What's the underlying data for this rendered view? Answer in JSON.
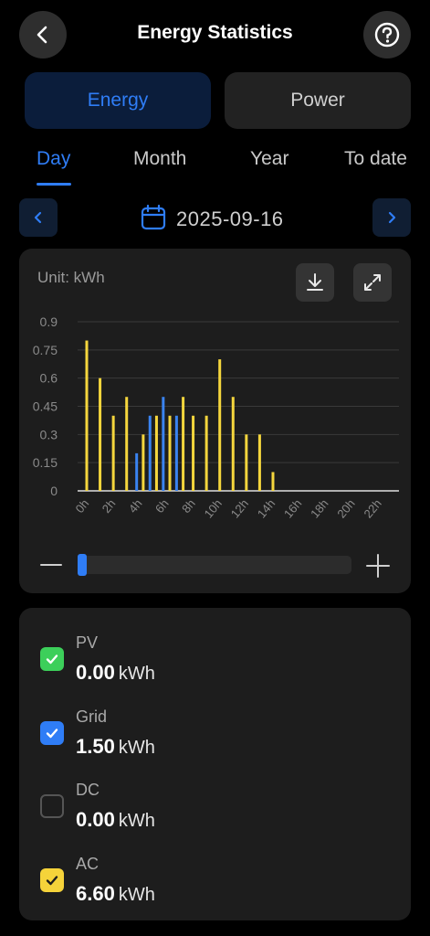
{
  "header": {
    "title": "Energy Statistics"
  },
  "segments": {
    "energy": "Energy",
    "power": "Power"
  },
  "tabs": [
    {
      "label": "Day"
    },
    {
      "label": "Month"
    },
    {
      "label": "Year"
    },
    {
      "label": "To date"
    }
  ],
  "date": {
    "value": "2025-09-16"
  },
  "chart_card": {
    "unit_label": "Unit: kWh"
  },
  "chart_data": {
    "type": "bar",
    "x": [
      "0h",
      "1h",
      "2h",
      "3h",
      "4h",
      "5h",
      "6h",
      "7h",
      "8h",
      "9h",
      "10h",
      "11h",
      "12h",
      "13h",
      "14h",
      "15h",
      "16h",
      "17h",
      "18h",
      "19h",
      "20h",
      "21h",
      "22h",
      "23h"
    ],
    "tick_labels": [
      "0h",
      "2h",
      "4h",
      "6h",
      "8h",
      "10h",
      "12h",
      "14h",
      "16h",
      "18h",
      "20h",
      "22h"
    ],
    "yticks": [
      "0",
      "0.15",
      "0.3",
      "0.45",
      "0.6",
      "0.75",
      "0.9"
    ],
    "ylim": [
      0,
      0.9
    ],
    "grid": true,
    "series": [
      {
        "color": "#f5d63d",
        "values": [
          0.8,
          0.6,
          0.4,
          0.5,
          0.3,
          0.4,
          0.4,
          0.5,
          0.4,
          0.4,
          0.7,
          0.5,
          0.3,
          0.3,
          0.1,
          0,
          0,
          0,
          0,
          0,
          0,
          0,
          0,
          0
        ]
      },
      {
        "color": "#3a83f0",
        "values": [
          0,
          0,
          0,
          0,
          0.2,
          0.4,
          0.5,
          0.4,
          0,
          0,
          0,
          0,
          0,
          0,
          0,
          0,
          0,
          0,
          0,
          0,
          0,
          0,
          0,
          0
        ]
      }
    ]
  },
  "legend": [
    {
      "name": "PV",
      "value": "0.00",
      "unit": "kWh",
      "checked": true,
      "color": "#3ccf5a"
    },
    {
      "name": "Grid",
      "value": "1.50",
      "unit": "kWh",
      "checked": true,
      "color": "#2f7df6"
    },
    {
      "name": "DC",
      "value": "0.00",
      "unit": "kWh",
      "checked": false,
      "color": "#555555"
    },
    {
      "name": "AC",
      "value": "6.60",
      "unit": "kWh",
      "checked": true,
      "color": "#f5d33a"
    }
  ],
  "icons": {
    "back": "chevron-left-icon",
    "help": "question-circle-icon",
    "calendar": "calendar-icon",
    "download": "download-icon",
    "expand": "expand-icon",
    "zoom_out": "minus-icon",
    "zoom_in": "plus-icon",
    "check": "check-icon"
  },
  "colors": {
    "accent": "#2f7df6",
    "card": "#1d1d1d",
    "background": "#000000"
  }
}
